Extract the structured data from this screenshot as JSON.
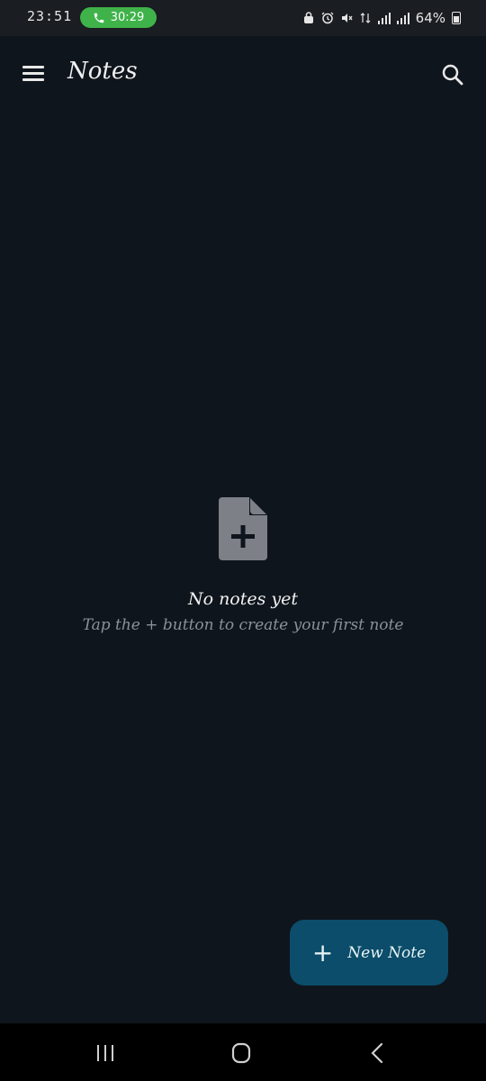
{
  "status_bar": {
    "time": "23:51",
    "call_timer": "30:29",
    "battery_percent": "64%",
    "call_color": "#3fb34a"
  },
  "app_bar": {
    "title": "Notes",
    "menu_icon": "hamburger-menu-icon",
    "search_icon": "search-icon"
  },
  "empty_state": {
    "icon": "note-add-icon",
    "title": "No notes yet",
    "subtitle": "Tap the + button to create your first note"
  },
  "fab": {
    "icon": "plus-icon",
    "label": "New Note",
    "color": "#0b4d6a"
  },
  "nav_bar": {
    "recent_icon": "recent-apps-icon",
    "home_icon": "home-icon",
    "back_icon": "back-icon"
  }
}
